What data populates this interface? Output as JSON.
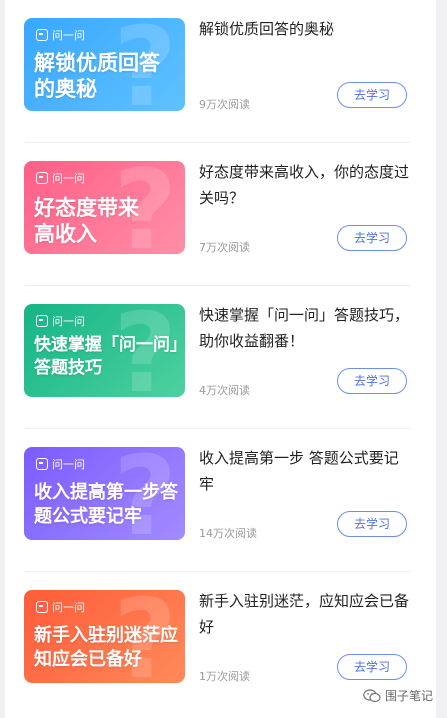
{
  "course_list": {
    "brand_label": "问一问",
    "items": [
      {
        "thumb_text": "解锁优质回答的奥秘",
        "title": "解锁优质回答的奥秘",
        "reads": "9万次阅读",
        "button": "去学习",
        "gradient": [
          "#39a7ff",
          "#5fc2ff"
        ]
      },
      {
        "thumb_text": "好态度带来高收入",
        "title": "好态度带来高收入，你的态度过关吗？",
        "reads": "7万次阅读",
        "button": "去学习",
        "gradient": [
          "#ff5e86",
          "#ff8fa6"
        ]
      },
      {
        "thumb_text": "快速掌握「问一问」答题技巧",
        "title": "快速掌握「问一问」答题技巧，助你收益翻番！",
        "reads": "4万次阅读",
        "button": "去学习",
        "gradient": [
          "#14b586",
          "#4ed1a0"
        ]
      },
      {
        "thumb_text": "收入提高第一步答题公式要记牢",
        "title": "收入提高第一步 答题公式要记牢",
        "reads": "14万次阅读",
        "button": "去学习",
        "gradient": [
          "#7a5cff",
          "#a38bff"
        ]
      },
      {
        "thumb_text": "新手入驻别迷茫应知应会已备好",
        "title": "新手入驻别迷茫，应知应会已备好",
        "reads": "1万次阅读",
        "button": "去学习",
        "gradient": [
          "#ff5b39",
          "#ff8a5a"
        ]
      }
    ]
  },
  "watermark": {
    "text": "围子笔记",
    "icon": "wechat-icon"
  }
}
